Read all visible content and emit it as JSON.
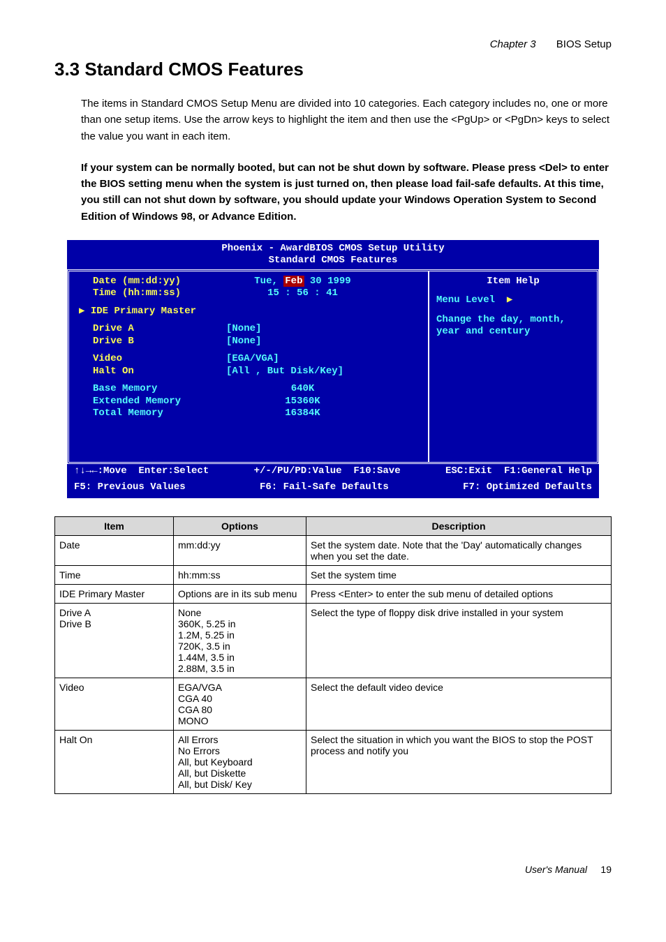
{
  "header": {
    "left": "Chapter 3",
    "right": "BIOS Setup"
  },
  "section_title": "3.3 Standard CMOS Features",
  "para1": "The items in Standard CMOS Setup Menu are divided into 10 categories. Each category includes no, one or more than one setup items. Use the arrow keys to highlight the item and then use the <PgUp> or <PgDn> keys to select the value you want in each item.",
  "para2": "If your system can be normally booted, but can not be shut down by software. Please press <Del> to enter the BIOS setting menu when the system is just turned on, then please load fail-safe defaults. At this time, you still can not shut down by software, you should update your Windows Operation System to Second Edition of Windows 98, or Advance Edition.",
  "bios": {
    "title1": "Phoenix - AwardBIOS CMOS Setup Utility",
    "title2": "Standard CMOS Features",
    "rows": {
      "date_label": "Date (mm:dd:yy)",
      "date_val_pre": "Tue, ",
      "date_val_hl": "Feb",
      "date_val_post": " 30 1999",
      "time_label": "Time (hh:mm:ss)",
      "time_val": "15 : 56 : 41",
      "ide": "IDE Primary Master",
      "drivea_label": "Drive A",
      "drivea_val": "[None]",
      "driveb_label": "Drive B",
      "driveb_val": "[None]",
      "video_label": "Video",
      "video_val": "[EGA/VGA]",
      "halt_label": "Halt On",
      "halt_val": "[All , But Disk/Key]",
      "basem_label": "Base Memory",
      "basem_val": "640K",
      "extm_label": "Extended Memory",
      "extm_val": "15360K",
      "totm_label": "Total Memory",
      "totm_val": "16384K"
    },
    "help": {
      "title": "Item Help",
      "menu_level": "Menu Level",
      "text": "Change the day, month, year and century"
    },
    "footer": {
      "l1a": "↑↓→←:Move  Enter:Select",
      "l1b": "+/-/PU/PD:Value  F10:Save",
      "l1c": "ESC:Exit  F1:General Help",
      "l2a": "F5: Previous Values",
      "l2b": "F6: Fail-Safe Defaults",
      "l2c": "F7: Optimized Defaults"
    }
  },
  "table": {
    "head": {
      "item": "Item",
      "options": "Options",
      "desc": "Description"
    },
    "rows": [
      {
        "item": "Date",
        "opt": "mm:dd:yy",
        "desc": "Set the system date.   Note that the 'Day' automatically changes when you set the date."
      },
      {
        "item": "Time",
        "opt": "hh:mm:ss",
        "desc": "Set the system time"
      },
      {
        "item": "IDE Primary Master",
        "opt": "Options are in its sub menu",
        "desc": "Press <Enter> to enter the sub menu of detailed options"
      },
      {
        "item": "Drive A\nDrive B",
        "opt": "None\n360K, 5.25 in\n1.2M, 5.25 in\n720K, 3.5 in\n1.44M, 3.5 in\n2.88M, 3.5 in",
        "desc": "Select the type of floppy disk drive installed in your system"
      },
      {
        "item": "Video",
        "opt": "EGA/VGA\nCGA 40\nCGA 80\nMONO",
        "desc": "Select the default video device"
      },
      {
        "item": "Halt On",
        "opt": "All Errors\nNo Errors\nAll, but Keyboard\nAll, but Diskette\nAll, but Disk/ Key",
        "desc": "Select the situation in which you want the BIOS to stop the POST process and notify you"
      }
    ]
  },
  "footer": {
    "text": "User's Manual",
    "page": "19"
  }
}
